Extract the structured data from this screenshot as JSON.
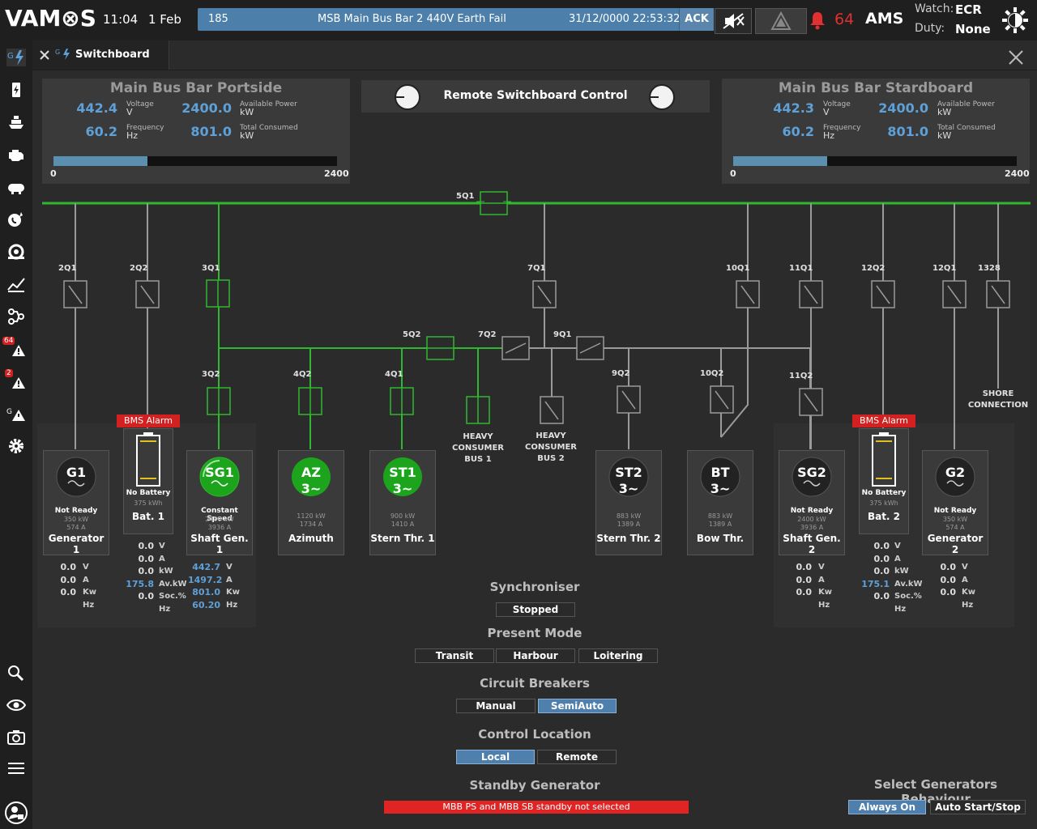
{
  "topbar": {
    "logo": "VAM⊗S",
    "time": "11:04",
    "date": "1 Feb",
    "alarm": {
      "id": "185",
      "text": "MSB Main Bus Bar 2 440V Earth Fail",
      "timestamp": "31/12/0000 22:53:32",
      "ack_label": "ACK"
    },
    "alarm_count": "64",
    "ams_label": "AMS",
    "watch_label": "Watch:",
    "watch_value": "ECR",
    "duty_label": "Duty:",
    "duty_value": "None"
  },
  "sidebar": {
    "badge1": "64",
    "badge2": "2"
  },
  "tab": {
    "label": "Switchboard"
  },
  "portside": {
    "title": "Main Bus Bar Portside",
    "voltage": "442.4",
    "voltage_label": "Voltage",
    "voltage_unit": "V",
    "frequency": "60.2",
    "frequency_label": "Frequency",
    "frequency_unit": "Hz",
    "available_power": "2400.0",
    "available_power_label": "Available Power",
    "available_power_unit": "kW",
    "total_consumed": "801.0",
    "total_consumed_label": "Total Consumed",
    "total_consumed_unit": "kW",
    "bar_min": "0",
    "bar_max": "2400",
    "bar_fraction": 0.33
  },
  "remote": {
    "label": "Remote Switchboard Control"
  },
  "starboard": {
    "title": "Main Bus Bar Stardboard",
    "voltage": "442.3",
    "voltage_label": "Voltage",
    "voltage_unit": "V",
    "frequency": "60.2",
    "frequency_label": "Frequency",
    "frequency_unit": "Hz",
    "available_power": "2400.0",
    "available_power_label": "Available Power",
    "available_power_unit": "kW",
    "total_consumed": "801.0",
    "total_consumed_label": "Total Consumed",
    "total_consumed_unit": "kW",
    "bar_min": "0",
    "bar_max": "2400",
    "bar_fraction": 0.33
  },
  "breakers": {
    "b5q1": "5Q1",
    "b2q1": "2Q1",
    "b2q2": "2Q2",
    "b3q1": "3Q1",
    "b7q1": "7Q1",
    "b10q1": "10Q1",
    "b11q1": "11Q1",
    "b12q2": "12Q2",
    "b12q1": "12Q1",
    "b1328": "1328",
    "b5q2": "5Q2",
    "b7q2": "7Q2",
    "b9q1": "9Q1",
    "b3q2": "3Q2",
    "b4q2": "4Q2",
    "b4q1": "4Q1",
    "b9q2": "9Q2",
    "b10q2": "10Q2",
    "b11q2": "11Q2"
  },
  "consumers": {
    "hcb1": [
      "HEAVY",
      "CONSUMER",
      "BUS 1"
    ],
    "hcb2": [
      "HEAVY",
      "CONSUMER",
      "BUS 2"
    ],
    "shore": [
      "SHORE",
      "CONNECTION"
    ]
  },
  "bms_alarm": "BMS Alarm",
  "units": {
    "v": "V",
    "a": "A",
    "kw": "kW",
    "kw2": "Kw",
    "hz": "Hz",
    "avkw": "Av.kW",
    "soc": "Soc.%"
  },
  "units_col_g": [
    "V",
    "A",
    "Kw",
    "Hz"
  ],
  "units_col_bat": [
    "V",
    "A",
    "kW",
    "Av.kW",
    "Soc.%",
    "Hz"
  ],
  "units_col_sg": [
    "V",
    "A",
    "Kw",
    "Hz"
  ],
  "g1": {
    "symbol": "G1",
    "status": "Not Ready",
    "rating": "350 kW",
    "current": "574 A",
    "name": "Generator 1",
    "values": [
      "0.0",
      "0.0",
      "0.0"
    ]
  },
  "bat1": {
    "status": "No Battery",
    "capacity": "375 kWh",
    "name": "Bat. 1",
    "values": [
      "0.0",
      "0.0",
      "0.0",
      "175.8",
      "0.0"
    ]
  },
  "sg1": {
    "symbol": "SG1",
    "status": "Constant Speed",
    "rating": "2400 kW",
    "current": "3936 A",
    "name": "Shaft Gen. 1",
    "values": [
      "442.7",
      "1497.2",
      "801.0",
      "60.20"
    ]
  },
  "az": {
    "symbol": "AZ",
    "phase": "3~",
    "rating": "1120 kW",
    "current": "1734 A",
    "name": "Azimuth"
  },
  "st1": {
    "symbol": "ST1",
    "phase": "3~",
    "rating": "900 kW",
    "current": "1410 A",
    "name": "Stern Thr. 1"
  },
  "st2": {
    "symbol": "ST2",
    "phase": "3~",
    "rating": "883 kW",
    "current": "1389 A",
    "name": "Stern Thr. 2"
  },
  "bt": {
    "symbol": "BT",
    "phase": "3~",
    "rating": "883 kW",
    "current": "1389 A",
    "name": "Bow Thr."
  },
  "sg2": {
    "symbol": "SG2",
    "status": "Not Ready",
    "rating": "2400 kW",
    "current": "3936 A",
    "name": "Shaft Gen. 2",
    "values": [
      "0.0",
      "0.0",
      "0.0"
    ]
  },
  "bat2": {
    "status": "No Battery",
    "capacity": "375 kWh",
    "name": "Bat. 2",
    "values": [
      "0.0",
      "0.0",
      "0.0",
      "175.1",
      "0.0"
    ]
  },
  "g2": {
    "symbol": "G2",
    "status": "Not Ready",
    "rating": "350 kW",
    "current": "574 A",
    "name": "Generator 2",
    "values": [
      "0.0",
      "0.0",
      "0.0"
    ]
  },
  "controls": {
    "synchroniser": {
      "title": "Synchroniser",
      "state": "Stopped"
    },
    "present_mode": {
      "title": "Present Mode",
      "options": [
        "Transit",
        "Harbour",
        "Loitering"
      ]
    },
    "circuit_breakers": {
      "title": "Circuit Breakers",
      "options": [
        "Manual",
        "SemiAuto"
      ],
      "selected": "SemiAuto"
    },
    "control_location": {
      "title": "Control Location",
      "options": [
        "Local",
        "Remote"
      ],
      "selected": "Local"
    },
    "standby": {
      "title": "Standby Generator",
      "message": "MBB PS and MBB SB standby not selected"
    },
    "gen_behaviour": {
      "title": "Select Generators Behaviour",
      "options": [
        "Always On",
        "Auto Start/Stop"
      ],
      "selected": "Always On"
    }
  },
  "colors": {
    "bus_green": "#2fb82f",
    "bus_grey": "#9a9a9a",
    "accent_blue": "#5ea0d8",
    "alarm_red": "#d32020"
  }
}
